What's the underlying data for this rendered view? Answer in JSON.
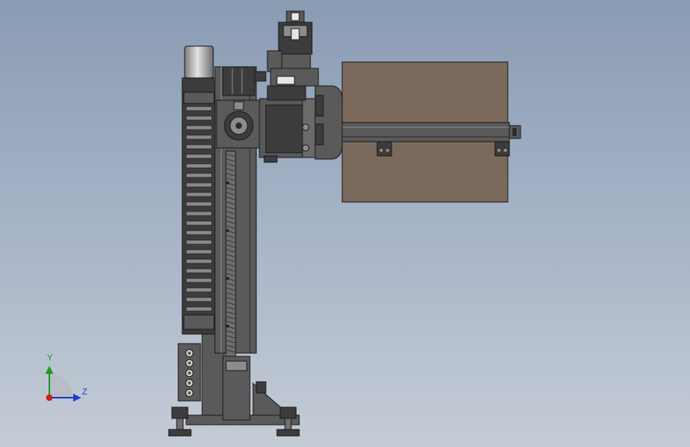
{
  "window": {
    "background_top": "#8a9bb4",
    "background_bottom": "#c4ccd6"
  },
  "model": {
    "edge_color": "#1a1a1a",
    "body_color": "#5a5a5a",
    "dark_color": "#3c3c3c",
    "light_color": "#8c8c8c",
    "cabinet_color": "#7b6a5b",
    "roller_light": "#e4e4e4"
  },
  "triad": {
    "y_label": "Y",
    "z_label": "Z",
    "y_color": "#1a9a1a",
    "z_color": "#1f3ccf",
    "origin_color": "#cc1a1a"
  }
}
